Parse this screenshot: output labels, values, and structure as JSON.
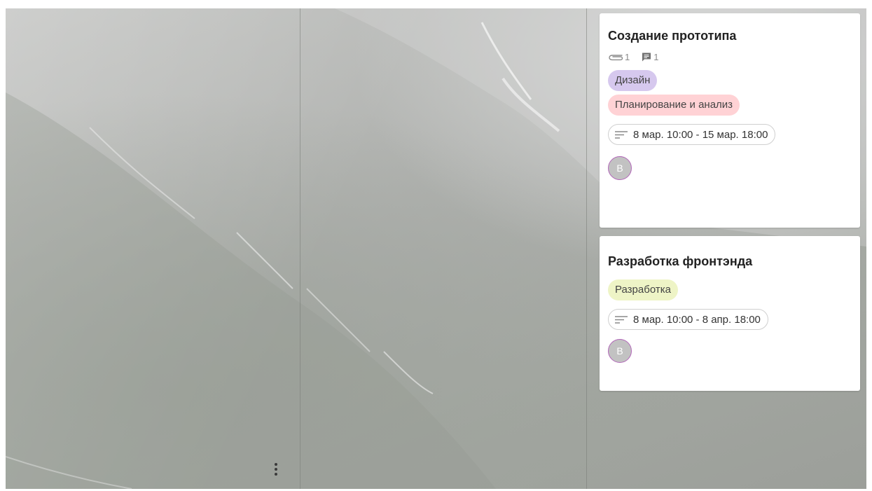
{
  "cards": [
    {
      "title": "Создание прототипа",
      "attachments": "1",
      "comments": "1",
      "tags": [
        {
          "label": "Дизайн",
          "color": "#d6c8ee"
        },
        {
          "label": "Планирование и анализ",
          "color": "#ffd2d5"
        }
      ],
      "dates": "8 мар. 10:00 - 15 мар. 18:00",
      "assignee": "В",
      "icons": [
        "paperclip-icon",
        "comment-icon",
        "lines-icon"
      ]
    },
    {
      "title": "Разработка фронтэнда",
      "tags": [
        {
          "label": "Разработка",
          "color": "#eef4c6"
        }
      ],
      "dates": "8 мар. 10:00 - 8 апр. 18:00",
      "assignee": "В",
      "icons": [
        "lines-icon"
      ]
    }
  ],
  "column_menu": {
    "icon": "more-vertical-icon"
  },
  "colors": {
    "avatar_ring": "#b267b9",
    "avatar_fill": "#c2c2c2"
  }
}
